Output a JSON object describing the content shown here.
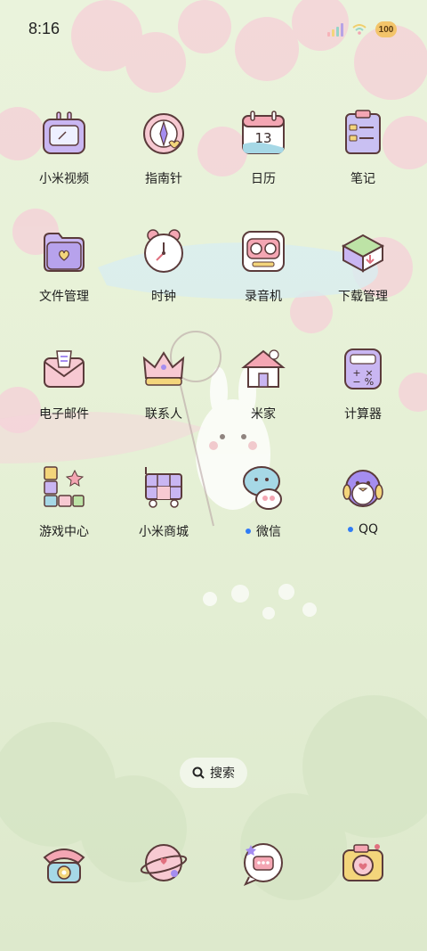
{
  "status": {
    "time": "8:16",
    "battery": "100"
  },
  "apps": [
    [
      {
        "name": "小米视频",
        "icon": "tv-icon"
      },
      {
        "name": "指南针",
        "icon": "compass-icon"
      },
      {
        "name": "日历",
        "icon": "calendar-icon",
        "calendar_day": "13"
      },
      {
        "name": "笔记",
        "icon": "notes-icon"
      }
    ],
    [
      {
        "name": "文件管理",
        "icon": "folder-icon"
      },
      {
        "name": "时钟",
        "icon": "clock-icon"
      },
      {
        "name": "录音机",
        "icon": "recorder-icon"
      },
      {
        "name": "下载管理",
        "icon": "download-icon"
      }
    ],
    [
      {
        "name": "电子邮件",
        "icon": "mail-icon"
      },
      {
        "name": "联系人",
        "icon": "contacts-crown-icon"
      },
      {
        "name": "米家",
        "icon": "home-icon"
      },
      {
        "name": "计算器",
        "icon": "calculator-icon"
      }
    ],
    [
      {
        "name": "游戏中心",
        "icon": "game-icon"
      },
      {
        "name": "小米商城",
        "icon": "store-cart-icon"
      },
      {
        "name": "微信",
        "icon": "wechat-icon",
        "new": true
      },
      {
        "name": "QQ",
        "icon": "qq-penguin-icon",
        "new": true
      }
    ]
  ],
  "search": {
    "label": "搜索"
  },
  "dock": [
    {
      "icon": "phone-icon"
    },
    {
      "icon": "browser-planet-icon"
    },
    {
      "icon": "messages-icon"
    },
    {
      "icon": "camera-icon"
    }
  ],
  "colors": {
    "accent_dot": "#2f7cf6",
    "battery": "#f3c46a"
  }
}
